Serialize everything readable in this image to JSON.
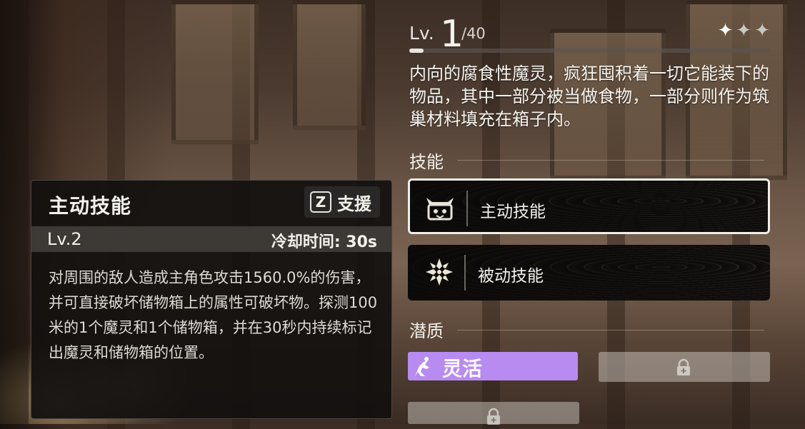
{
  "tooltip": {
    "title": "主动技能",
    "key": "Z",
    "key_label": "支援",
    "level": "Lv.2",
    "cooldown": "冷却时间: 30s",
    "description": "对周围的敌人造成主角色攻击1560.0%的伤害，并可直接破坏储物箱上的属性可破坏物。探测100米的1个魔灵和1个储物箱，并在30秒内持续标记出魔灵和储物箱的位置。"
  },
  "level": {
    "prefix": "Lv.",
    "current": "1",
    "max": "/40",
    "progress_fraction": 0.04,
    "stars_total": 3,
    "stars_filled": 1
  },
  "description": "内向的腐食性魔灵，疯狂囤积着一切它能装下的物品，其中一部分被当做食物，一部分则作为筑巢材料填充在箱子内。",
  "skills": {
    "heading": "技能",
    "items": [
      {
        "label": "主动技能",
        "icon": "chest-creature-icon",
        "selected": true
      },
      {
        "label": "被动技能",
        "icon": "snowflake-emblem-icon",
        "selected": false
      }
    ]
  },
  "traits": {
    "heading": "潜质",
    "active": {
      "label": "灵活",
      "icon": "agility-figure-icon"
    },
    "locked_count": 2
  },
  "colors": {
    "trait_purple": "#b78bf0",
    "panel_dark": "#121110",
    "text": "#f2f0ea"
  }
}
